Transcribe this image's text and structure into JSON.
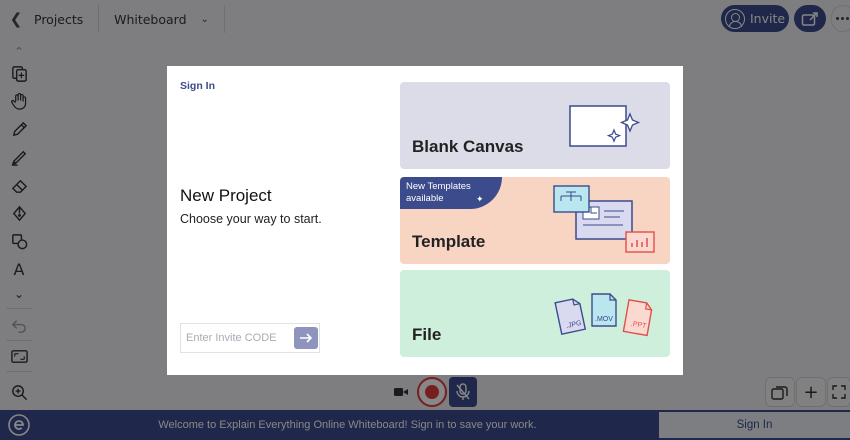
{
  "header": {
    "back_label": "Projects",
    "board_label": "Whiteboard",
    "invite_label": "Invite"
  },
  "modal": {
    "signin_label": "Sign In",
    "title": "New Project",
    "subtitle": "Choose your way to start.",
    "invite_placeholder": "Enter Invite CODE",
    "invite_value": "",
    "cards": [
      {
        "label": "Blank Canvas"
      },
      {
        "label": "Template",
        "badge_line1": "New Templates",
        "badge_line2": "available"
      },
      {
        "label": "File",
        "file_types": [
          ".JPG",
          ".MOV",
          ".PPT"
        ]
      }
    ]
  },
  "footer": {
    "message": "Welcome to Explain Everything Online Whiteboard! Sign in to save your work.",
    "signin_label": "Sign In"
  },
  "colors": {
    "brand": "#3b4b8c",
    "record": "#e23a3a",
    "blank_card": "#dcdce9",
    "template_card": "#f8d4c3",
    "file_card": "#cfefdd"
  },
  "icons": {
    "toolbar": [
      "chevron-up-icon",
      "copy-icon",
      "hand-icon",
      "pen-icon",
      "highlighter-icon",
      "eraser-icon",
      "fill-icon",
      "shapes-icon",
      "text-icon",
      "chevron-down-icon",
      "undo-icon",
      "frame-icon",
      "zoom-icon"
    ]
  }
}
